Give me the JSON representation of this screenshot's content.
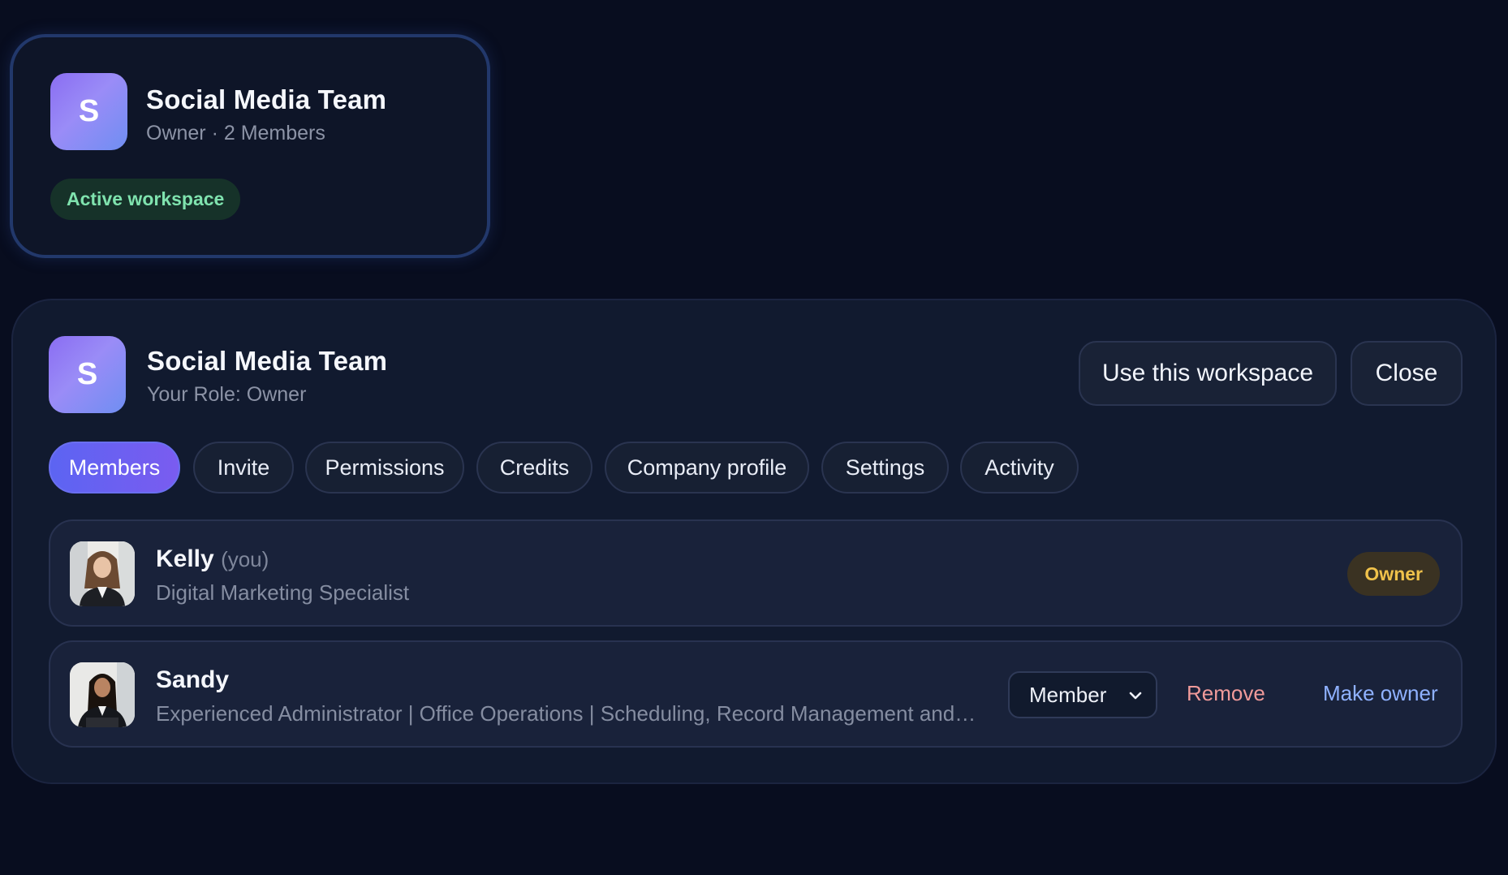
{
  "workspace_card": {
    "avatar_letter": "S",
    "title": "Social Media Team",
    "subtitle": "Owner · 2 Members",
    "active_badge": "Active workspace"
  },
  "detail": {
    "avatar_letter": "S",
    "title": "Social Media Team",
    "role_line": "Your Role: Owner",
    "use_button": "Use this workspace",
    "close_button": "Close",
    "tabs": [
      {
        "label": "Members",
        "active": true
      },
      {
        "label": "Invite"
      },
      {
        "label": "Permissions"
      },
      {
        "label": "Credits"
      },
      {
        "label": "Company profile"
      },
      {
        "label": "Settings"
      },
      {
        "label": "Activity"
      }
    ],
    "members": [
      {
        "name": "Kelly",
        "you_tag": "(you)",
        "headline": "Digital Marketing Specialist",
        "badge": "Owner",
        "avatar_icon": "avatar-photo-kelly"
      },
      {
        "name": "Sandy",
        "headline": "Experienced Administrator | Office Operations | Scheduling, Record Management and Client Support",
        "role_value": "Member",
        "remove_label": "Remove",
        "make_owner_label": "Make owner",
        "avatar_icon": "avatar-photo-sandy"
      }
    ]
  },
  "colors": {
    "background": "#080d1f",
    "panel": "#111a2f",
    "accent": "#6366f1",
    "active_badge_text": "#7fe3ae",
    "owner_badge_text": "#f0c24b",
    "remove_text": "#f09a9a",
    "make_owner_text": "#8fb1ff"
  }
}
